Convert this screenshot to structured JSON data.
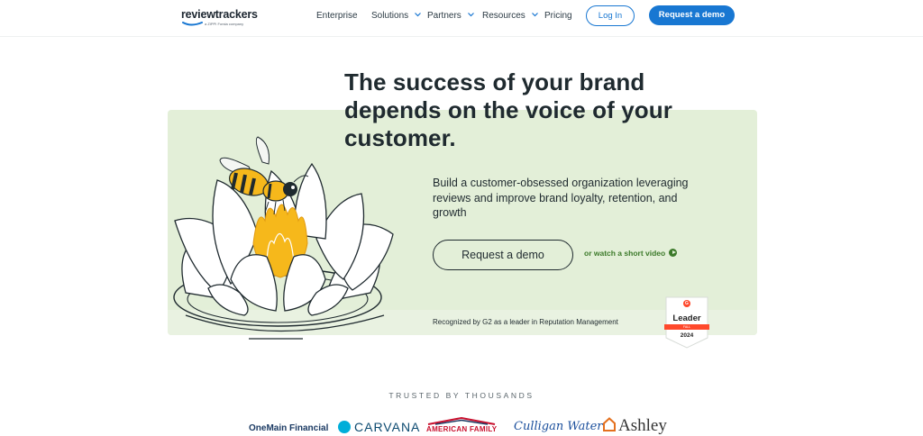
{
  "nav": {
    "logo_text": "reviewtrackers",
    "logo_tagline": "a ZIPPI Forsta company",
    "links": [
      {
        "label": "Enterprise",
        "has_dropdown": false
      },
      {
        "label": "Solutions",
        "has_dropdown": true
      },
      {
        "label": "Partners",
        "has_dropdown": true
      },
      {
        "label": "Resources",
        "has_dropdown": true
      },
      {
        "label": "Pricing",
        "has_dropdown": false
      }
    ],
    "login_label": "Log In",
    "demo_label": "Request a demo"
  },
  "hero": {
    "headline": "The success of your brand depends on the voice of your customer.",
    "subtext": "Build a customer-obsessed organization leveraging reviews and improve brand loyalty, retention, and growth",
    "cta_label": "Request a demo",
    "video_link": "or watch a short video",
    "video_icon": "play-circle-icon",
    "g2_text": "Recognized by G2 as a leader in Reputation Management",
    "g2_badge": {
      "logo": "G",
      "title": "Leader",
      "season": "FALL",
      "year": "2024"
    }
  },
  "trusted": {
    "heading": "TRUSTED BY THOUSANDS",
    "brands": [
      "OneMain Financial",
      "CARVANA",
      "AMERICAN FAMILY",
      "Culligan Water",
      "Ashley"
    ]
  },
  "colors": {
    "primary_blue": "#1877d2",
    "hero_green": "#e3efd8",
    "link_green": "#3c7a2a",
    "g2_red": "#ff492c",
    "bee_yellow": "#f6b81b"
  }
}
